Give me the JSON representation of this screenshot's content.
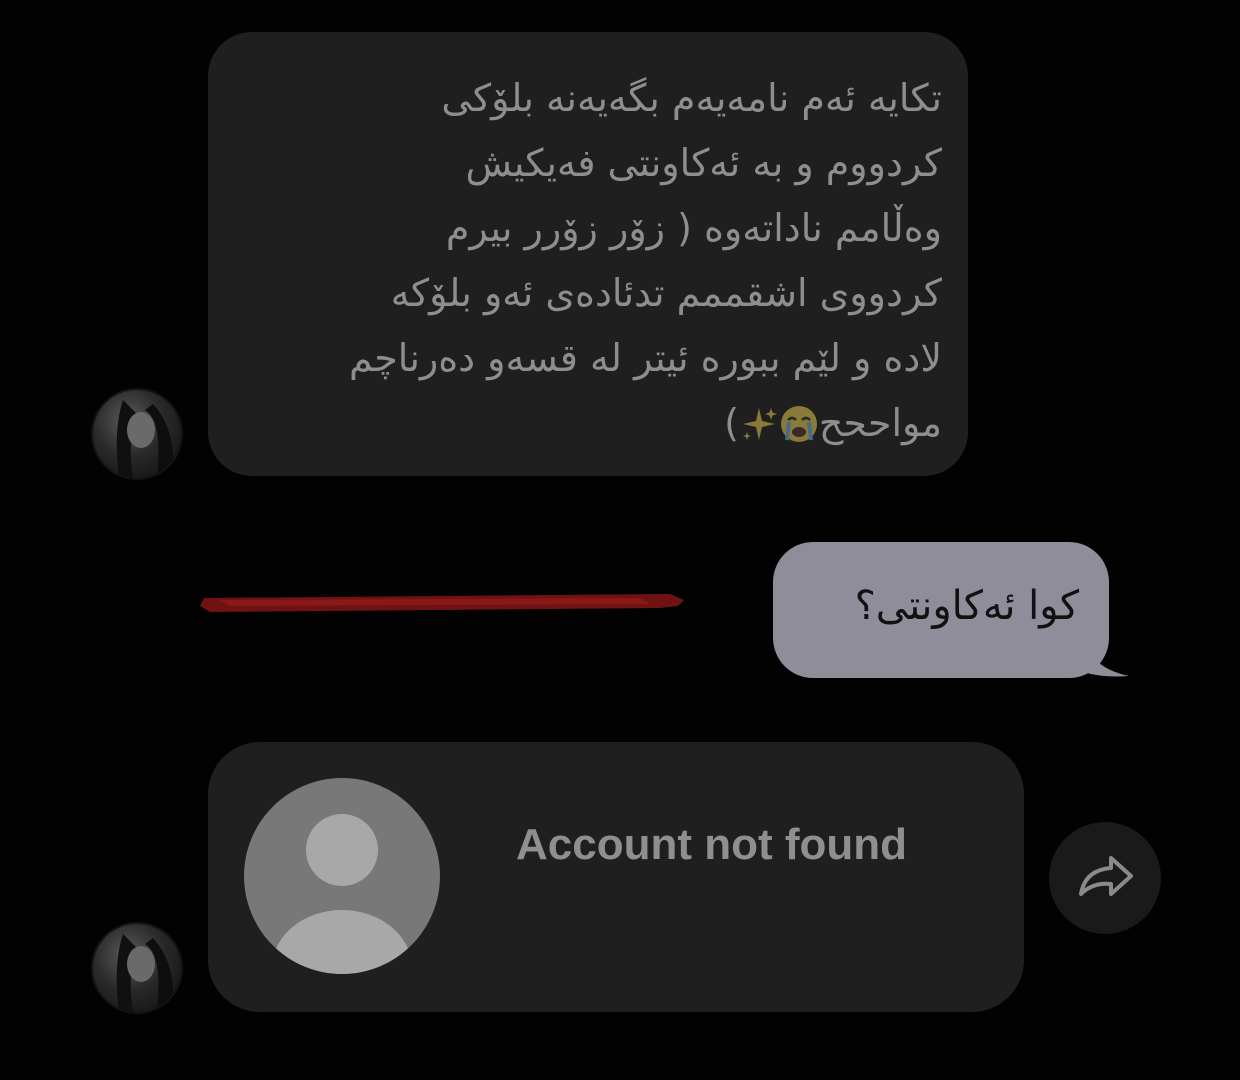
{
  "conversation": {
    "incoming_message": {
      "lines": [
        "تکایە ئەم نامەیەم بگەیەنە بلۆکی",
        "کردووم و بە ئەکاونتی فەیکیش",
        "وەڵامم ناداتەوە ( زۆر زۆرر بیرم",
        "کردووی اشقممم تدئادەی ئەو بلۆکە",
        "لادە و لێم ببورە ئیتر لە قسەو دەرناچم",
        "مواححح"
      ],
      "emojis": [
        "loudly-crying-face",
        "sparkles"
      ],
      "closing": ")"
    },
    "outgoing_message": {
      "text": "کوا ئەکاونتی؟"
    },
    "shared_account_card": {
      "title": "Account not found"
    }
  },
  "colors": {
    "background": "#020202",
    "incoming_bubble": "#1f1f1f",
    "incoming_text": "#8e8e8e",
    "outgoing_bubble": "#8e8d99",
    "redaction": "#7a1414",
    "card_title": "#8f8f8f"
  },
  "icons": {
    "share": "share-arrow-icon",
    "avatar_placeholder": "default-user-icon"
  }
}
